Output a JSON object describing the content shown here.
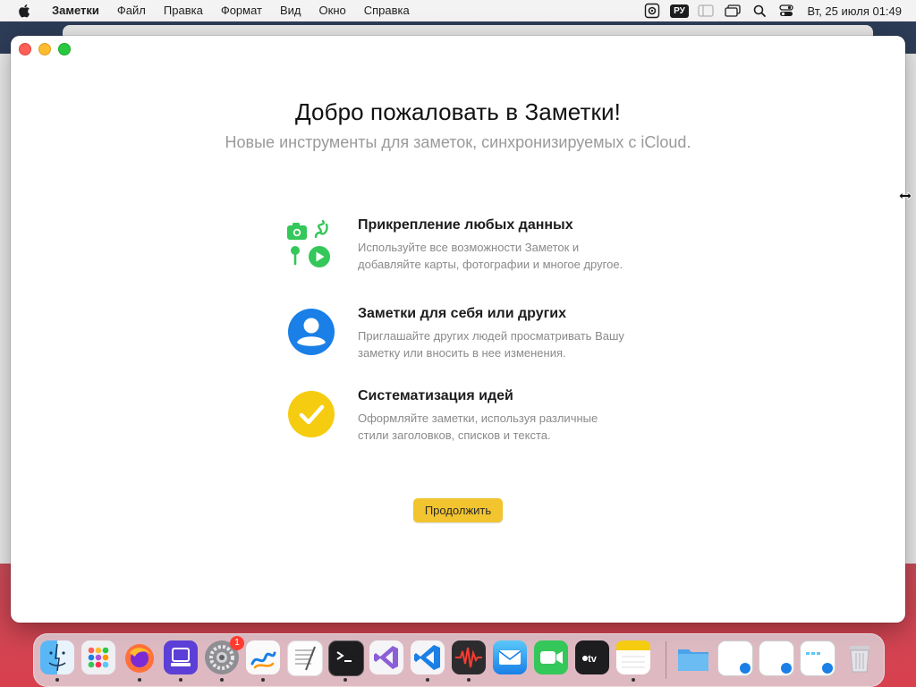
{
  "menubar": {
    "app_name": "Заметки",
    "items": [
      "Файл",
      "Правка",
      "Формат",
      "Вид",
      "Окно",
      "Справка"
    ],
    "keyboard_layout": "РУ",
    "clock": "Вт, 25 июля  01:49",
    "status_icons": [
      "gear-icon",
      "keyboard-layout-badge",
      "sidebar-icon",
      "windows-icon",
      "search-icon",
      "control-center-icon"
    ]
  },
  "welcome": {
    "title": "Добро пожаловать в Заметки!",
    "subtitle": "Новые инструменты для заметок, синхронизируемых с iCloud.",
    "features": [
      {
        "title": "Прикрепление любых данных",
        "description": "Используйте все возможности Заметок и добавляйте карты, фотографии и многое другое.",
        "icon": "attachments-icon"
      },
      {
        "title": "Заметки для себя или других",
        "description": "Приглашайте других людей просматривать Вашу заметку или вносить в нее изменения.",
        "icon": "person-icon"
      },
      {
        "title": "Систематизация идей",
        "description": "Оформляйте заметки, используя различные стили заголовков, списков и текста.",
        "icon": "checkmark-icon"
      }
    ],
    "continue_label": "Продолжить"
  },
  "colors": {
    "accent_yellow": "#f2c42f",
    "feature_green": "#34c759",
    "feature_blue": "#1a7fe6",
    "feature_yellow": "#f5cc10"
  },
  "dock": {
    "apps": [
      "finder",
      "launchpad",
      "firefox",
      "simulator",
      "system-settings",
      "freeform",
      "textedit",
      "terminal",
      "visual-studio",
      "vscode",
      "instruments",
      "mail",
      "facetime",
      "apple-tv",
      "notes"
    ],
    "system_settings_badge": "1",
    "right_items": [
      "downloads-folder",
      "minimized-window-1",
      "minimized-window-2",
      "minimized-window-3",
      "trash"
    ]
  }
}
